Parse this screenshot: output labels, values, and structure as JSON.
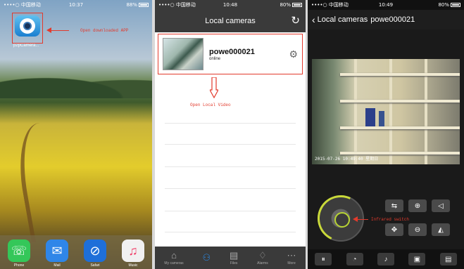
{
  "colors": {
    "annotation": "#e23a2c",
    "active_tab": "#2a8ae6",
    "joystick_ring": "#b8d433"
  },
  "screen1": {
    "status": {
      "carrier": "••••○ 中国移动 ",
      "time": "10:37",
      "battery": "88%"
    },
    "app_icon_label": "p2pCamera...",
    "annotation": "Open downloaded APP",
    "dock": [
      {
        "label": "Phone",
        "icon": "phone-icon",
        "glyph": "☏",
        "color": "#34c759"
      },
      {
        "label": "Mail",
        "icon": "mail-icon",
        "glyph": "✉",
        "color": "#2f86e8"
      },
      {
        "label": "Safari",
        "icon": "compass-icon",
        "glyph": "⊘",
        "color": "#1e6fd9"
      },
      {
        "label": "Music",
        "icon": "music-icon",
        "glyph": "♫",
        "color": "#f1f1f1"
      }
    ]
  },
  "screen2": {
    "status": {
      "carrier": "••••○ 中国移动 ",
      "time": "10:48",
      "battery": "80%"
    },
    "title": "Local cameras",
    "camera": {
      "name": "powe000021",
      "status": "online"
    },
    "annotation": "Open Local Video",
    "tabs": [
      {
        "label": "My cameras",
        "icon": "camera-tab-icon",
        "glyph": "⌂"
      },
      {
        "label": "",
        "icon": "local-tab-icon",
        "glyph": "⚇"
      },
      {
        "label": "Files",
        "icon": "files-tab-icon",
        "glyph": "▤"
      },
      {
        "label": "Alarms",
        "icon": "bell-tab-icon",
        "glyph": "♢"
      },
      {
        "label": "More",
        "icon": "more-tab-icon",
        "glyph": "⋯"
      }
    ]
  },
  "screen3": {
    "status": {
      "carrier": "••••○ 中国移动 ",
      "time": "10:49",
      "battery": "80%"
    },
    "back_label": "Local cameras",
    "title": "powe000021",
    "osd": "2015-07-26 10:49:40 星期日",
    "annotation": "Infrared switch"
  }
}
